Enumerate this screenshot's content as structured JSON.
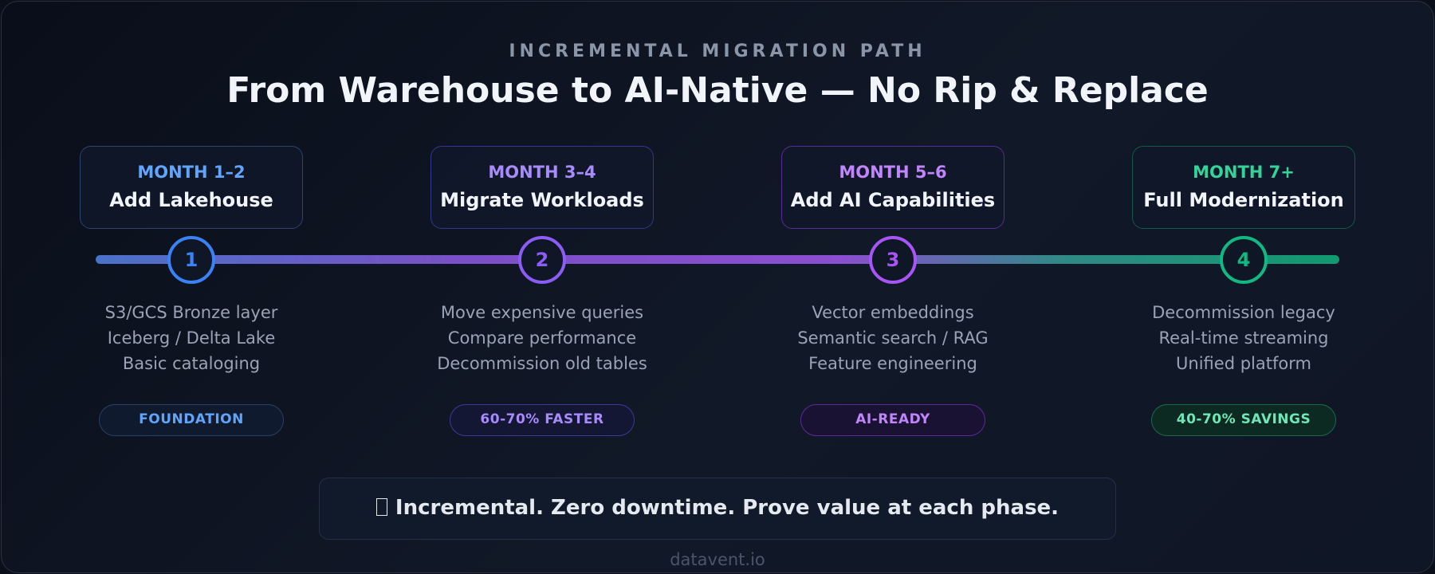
{
  "header": {
    "eyebrow": "INCREMENTAL MIGRATION PATH",
    "title": "From Warehouse to AI-Native — No Rip & Replace"
  },
  "phases": [
    {
      "number": "1",
      "period": "MONTH 1–2",
      "name": "Add Lakehouse",
      "details": [
        "S3/GCS Bronze layer",
        "Iceberg / Delta Lake",
        "Basic cataloging"
      ],
      "badge": "FOUNDATION",
      "accent": "#5b8def"
    },
    {
      "number": "2",
      "period": "MONTH 3–4",
      "name": "Migrate Workloads",
      "details": [
        "Move expensive queries",
        "Compare performance",
        "Decommission old tables"
      ],
      "badge": "60-70% FASTER",
      "accent": "#8b5cf6"
    },
    {
      "number": "3",
      "period": "MONTH 5–6",
      "name": "Add AI Capabilities",
      "details": [
        "Vector embeddings",
        "Semantic search / RAG",
        "Feature engineering"
      ],
      "badge": "AI-READY",
      "accent": "#a855f7"
    },
    {
      "number": "4",
      "period": "MONTH 7+",
      "name": "Full Modernization",
      "details": [
        "Decommission legacy",
        "Real-time streaming",
        "Unified platform"
      ],
      "badge": "40-70% SAVINGS",
      "accent": "#10b981"
    }
  ],
  "footer": {
    "message": "Incremental. Zero downtime. Prove value at each phase.",
    "icon": "box-icon"
  },
  "brand": "datavent.io"
}
